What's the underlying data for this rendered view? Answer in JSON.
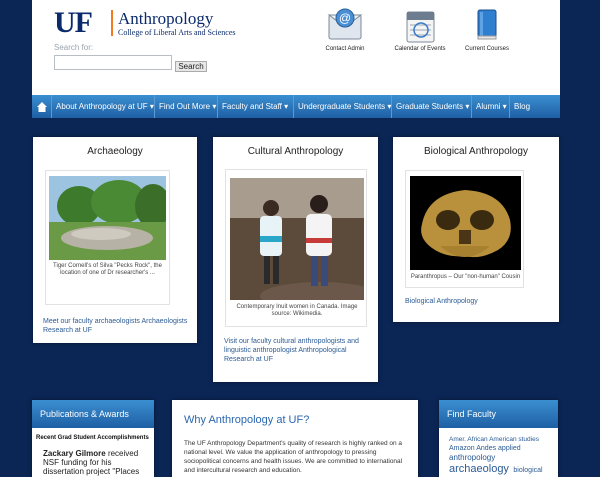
{
  "header": {
    "logo_uf": "UF",
    "title": "Anthropology",
    "subtitle": "College of Liberal Arts and Sciences",
    "search_label": "Search for:",
    "search_placeholder": "",
    "search_button": "Search",
    "quick_links": [
      {
        "label": "Contact Admin",
        "icon": "envelope-icon"
      },
      {
        "label": "Calendar of Events",
        "icon": "calendar-icon"
      },
      {
        "label": "Current Courses",
        "icon": "book-icon"
      }
    ]
  },
  "nav": {
    "items": [
      {
        "label": "About Anthropology at UF"
      },
      {
        "label": "Find Out More"
      },
      {
        "label": "Faculty and Staff"
      },
      {
        "label": "Undergraduate Students"
      },
      {
        "label": "Graduate Students"
      },
      {
        "label": "Alumni"
      },
      {
        "label": "Blog"
      }
    ]
  },
  "cards": {
    "archaeology": {
      "title": "Archaeology",
      "caption": "Tiger Cornell's of Silva \"Pecks Rock\", the location of one of Dr researcher's ...",
      "link": "Meet our faculty archaeologists Archaeologists Research at UF"
    },
    "cultural": {
      "title": "Cultural Anthropology",
      "caption": "Contemporary Inuit women in Canada. Image source: Wikimedia.",
      "link": "Visit our faculty cultural anthropologists and linguistic anthropologist Anthropological Research at UF"
    },
    "biological": {
      "title": "Biological Anthropology",
      "caption": "Paranthropus – Our \"non-human\" Cousin",
      "link": "Biological Anthropology"
    }
  },
  "bottom": {
    "publications": {
      "title": "Publications & Awards",
      "sub": "Recent Grad Student Accomplishments",
      "name": "Zackary Gilmore",
      "text": "received NSF funding for his dissertation project \"Places"
    },
    "why": {
      "title": "Why Anthropology at UF?",
      "text": "The UF Anthropology Department's quality of research is highly ranked on a national level. We value the application of anthropology to pressing sociopolitical concerns and health issues. We are committed to international and intercultural research and education."
    },
    "faculty": {
      "title": "Find Faculty",
      "tags_line1": "Amer. African American studies",
      "tags_line2": "Amazon Andes applied",
      "tags_line3": "anthropology",
      "tags_big": "archaeology",
      "tags_line4": "biological"
    }
  },
  "colors": {
    "background": "#0b2554",
    "nav": "#2a73bb",
    "brand_orange": "#f27b20",
    "brand_blue": "#0a2a6b"
  }
}
